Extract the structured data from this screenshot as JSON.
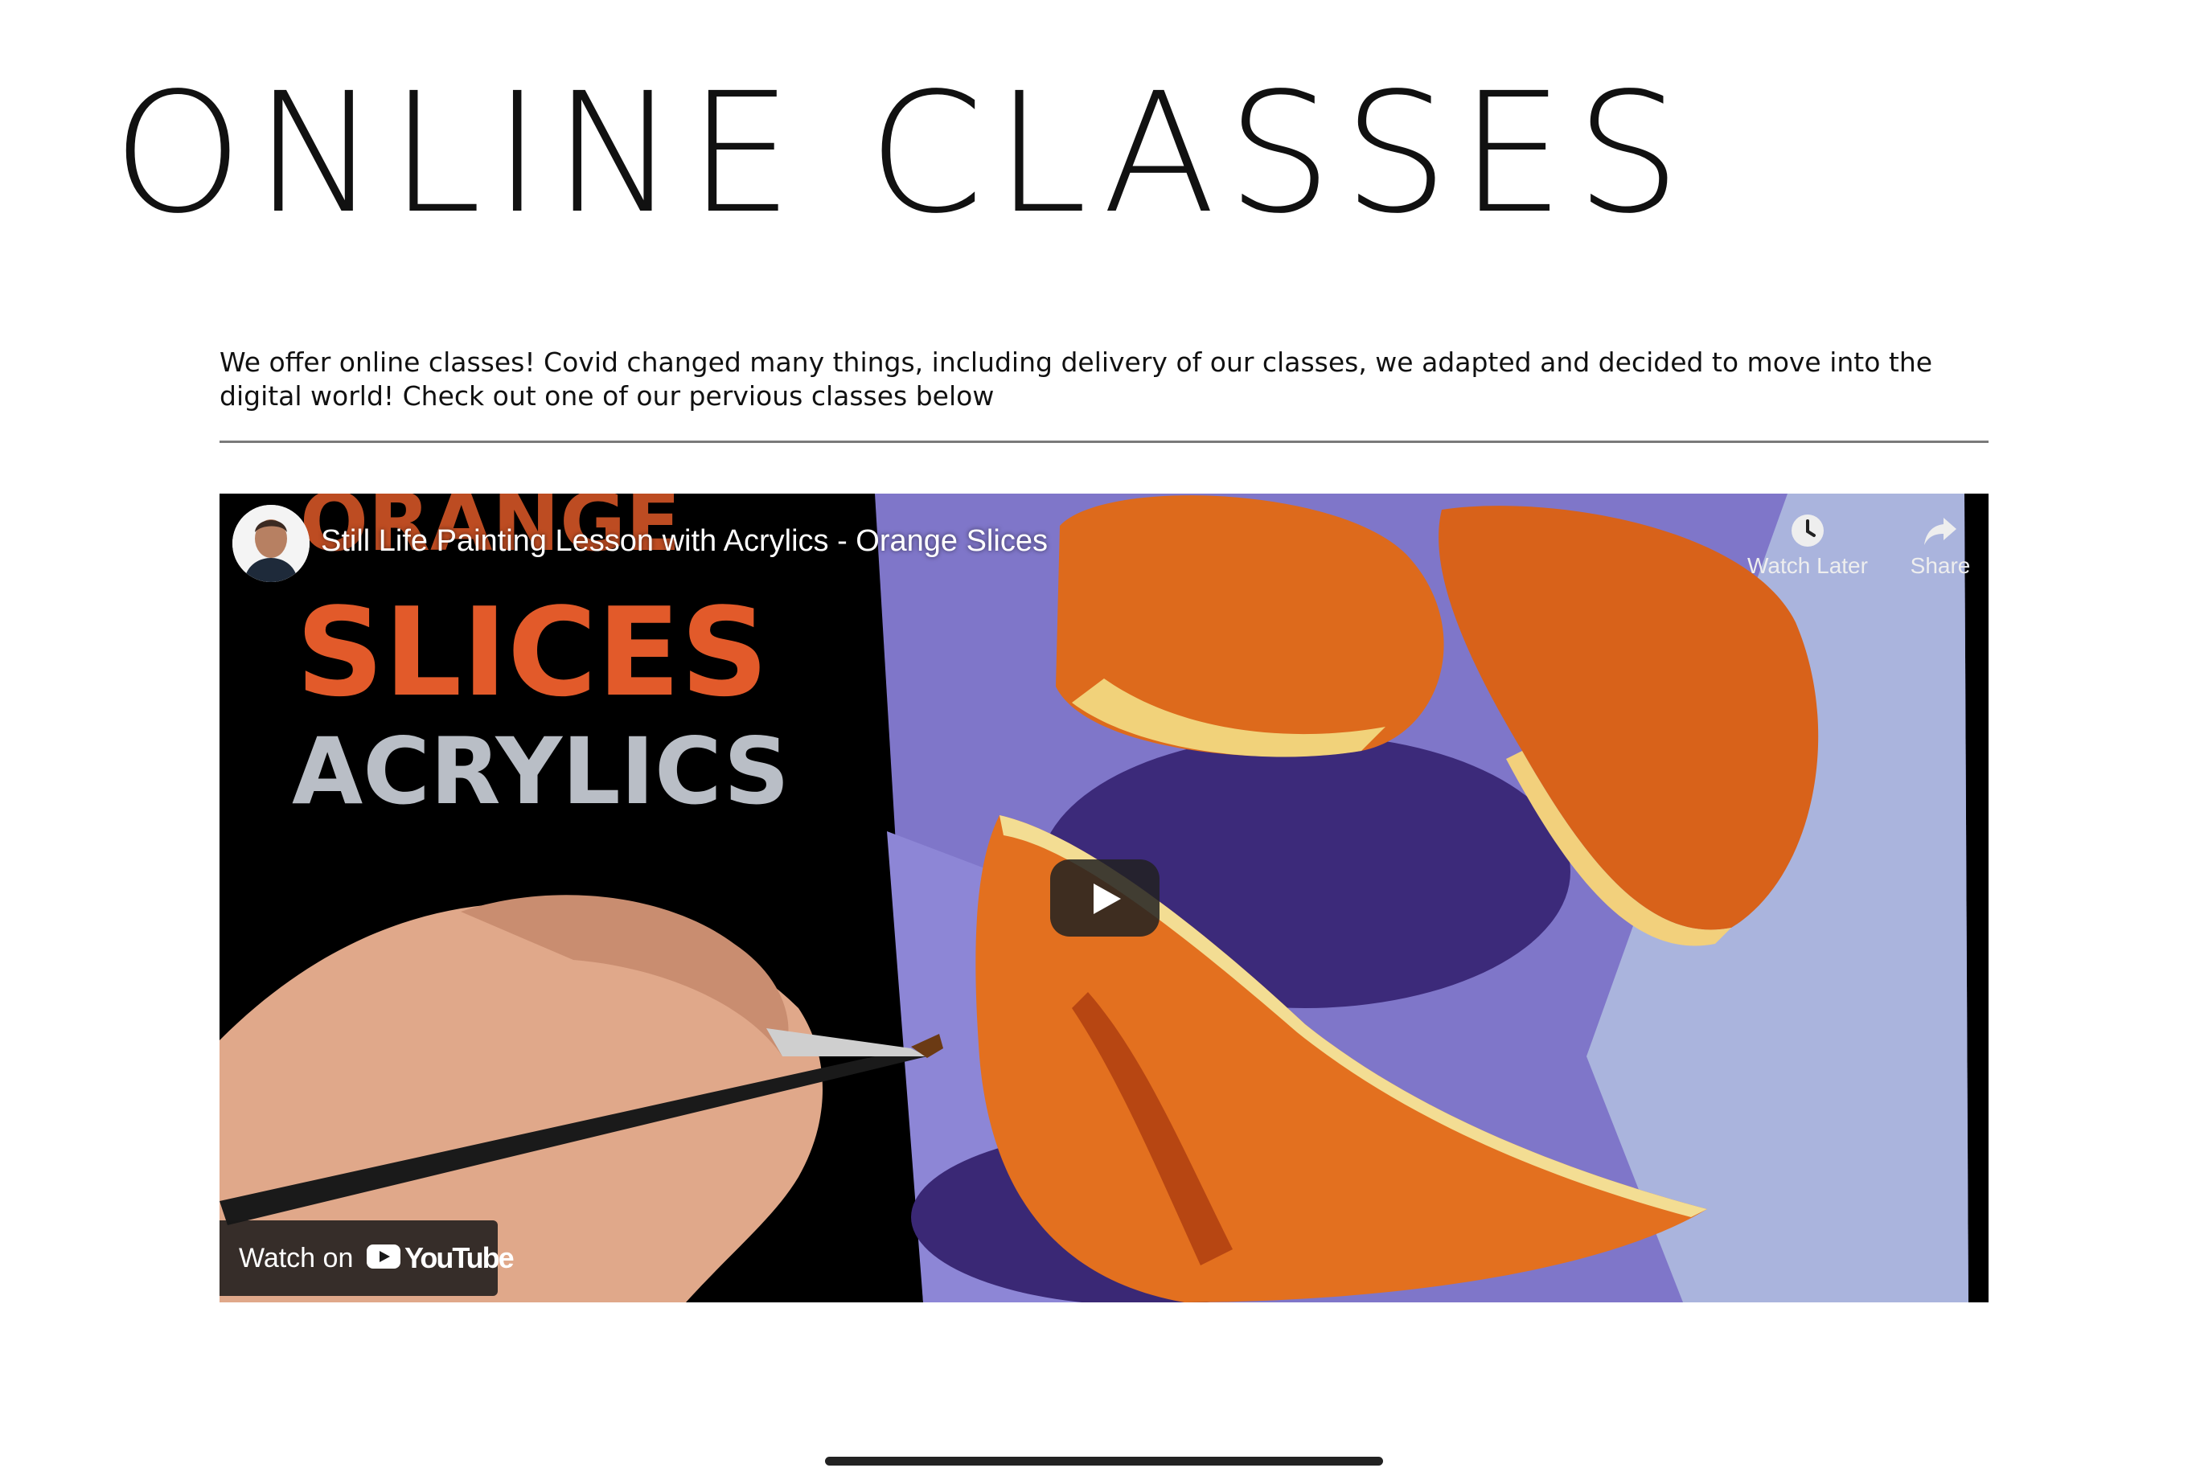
{
  "page": {
    "title": "ONLINE CLASSES",
    "intro": "We offer online classes! Covid changed many things, including delivery of our classes, we adapted and decided to move into the digital world! Check out one of our pervious classes below"
  },
  "video": {
    "title": "Still Life Painting Lesson with Acrylics - Orange Slices",
    "thumbnail_text": [
      "ORANGE",
      "SLICES",
      "ACRYLICS"
    ],
    "actions": [
      {
        "label": "Watch Later",
        "icon": "clock-icon"
      },
      {
        "label": "Share",
        "icon": "share-arrow-icon"
      }
    ],
    "play_icon": "play-icon",
    "watch_on_label": "Watch on",
    "youtube_label": "YouTube"
  },
  "colors": {
    "thumbnail_orange": "#e25a2a",
    "thumbnail_grey": "#b9bec6",
    "background_purple": "#7e74c8",
    "orange_slice": "#e46f1a"
  }
}
